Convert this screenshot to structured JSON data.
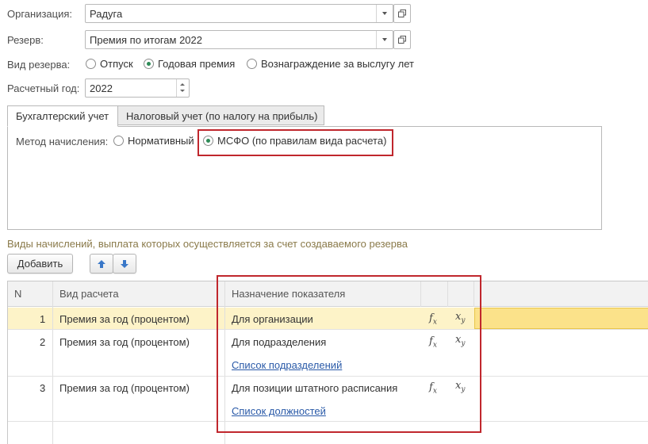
{
  "organization": {
    "label": "Организация:",
    "value": "Радуга"
  },
  "reserve": {
    "label": "Резерв:",
    "value": "Премия по итогам 2022"
  },
  "reserve_kind": {
    "label": "Вид резерва:",
    "options": [
      "Отпуск",
      "Годовая премия",
      "Вознаграждение за выслугу лет"
    ],
    "selected": "Годовая премия"
  },
  "calc_year": {
    "label": "Расчетный год:",
    "value": "2022"
  },
  "tabs": [
    "Бухгалтерский учет",
    "Налоговый учет (по налогу на прибыль)"
  ],
  "accrual_method": {
    "label": "Метод начисления:",
    "options": [
      "Нормативный",
      "МСФО (по правилам вида расчета)"
    ],
    "selected": "МСФО (по правилам вида расчета)"
  },
  "section_title": "Виды начислений, выплата которых осуществляется за счет создаваемого резерва",
  "toolbar": {
    "add_label": "Добавить"
  },
  "table": {
    "columns": [
      "N",
      "Вид расчета",
      "Назначение показателя"
    ],
    "fx_symbol": "fx",
    "xy_symbol": "xy",
    "rows": [
      {
        "n": "1",
        "calc": "Премия за год (процентом)",
        "purpose": "Для организации",
        "link": ""
      },
      {
        "n": "2",
        "calc": "Премия за год (процентом)",
        "purpose": "Для подразделения",
        "link": "Список подразделений"
      },
      {
        "n": "3",
        "calc": "Премия за год (процентом)",
        "purpose": "Для позиции штатного расписания",
        "link": "Список должностей"
      }
    ]
  },
  "colors": {
    "highlight_red": "#c0272d",
    "selected_row": "#fdf3c8",
    "link": "#2a5aa8",
    "radio_on": "#2e8b57"
  }
}
